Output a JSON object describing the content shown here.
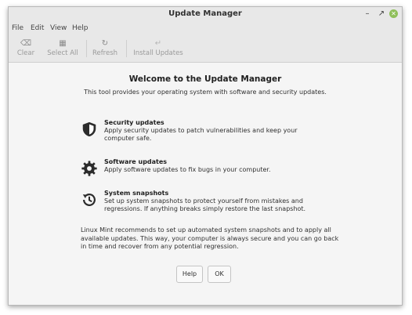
{
  "window": {
    "title": "Update Manager"
  },
  "menu": {
    "file": "File",
    "edit": "Edit",
    "view": "View",
    "help": "Help"
  },
  "toolbar": {
    "clear": "Clear",
    "select_all": "Select All",
    "refresh": "Refresh",
    "install_updates": "Install Updates"
  },
  "welcome": {
    "heading": "Welcome to the Update Manager",
    "subtitle": "This tool provides your operating system with software and security updates."
  },
  "features": [
    {
      "title": "Security updates",
      "description": "Apply security updates to patch vulnerabilities and keep your computer safe.",
      "icon": "shield-icon"
    },
    {
      "title": "Software updates",
      "description": "Apply software updates to fix bugs in your computer.",
      "icon": "gear-icon"
    },
    {
      "title": "System snapshots",
      "description": "Set up system snapshots to protect yourself from mistakes and regressions. If anything breaks simply restore the last snapshot.",
      "icon": "history-icon"
    }
  ],
  "recommendation": "Linux Mint recommends to set up automated system snapshots and to apply all available updates. This way, your computer is always secure and you can go back in time and recover from any potential regression.",
  "buttons": {
    "help": "Help",
    "ok": "OK"
  }
}
